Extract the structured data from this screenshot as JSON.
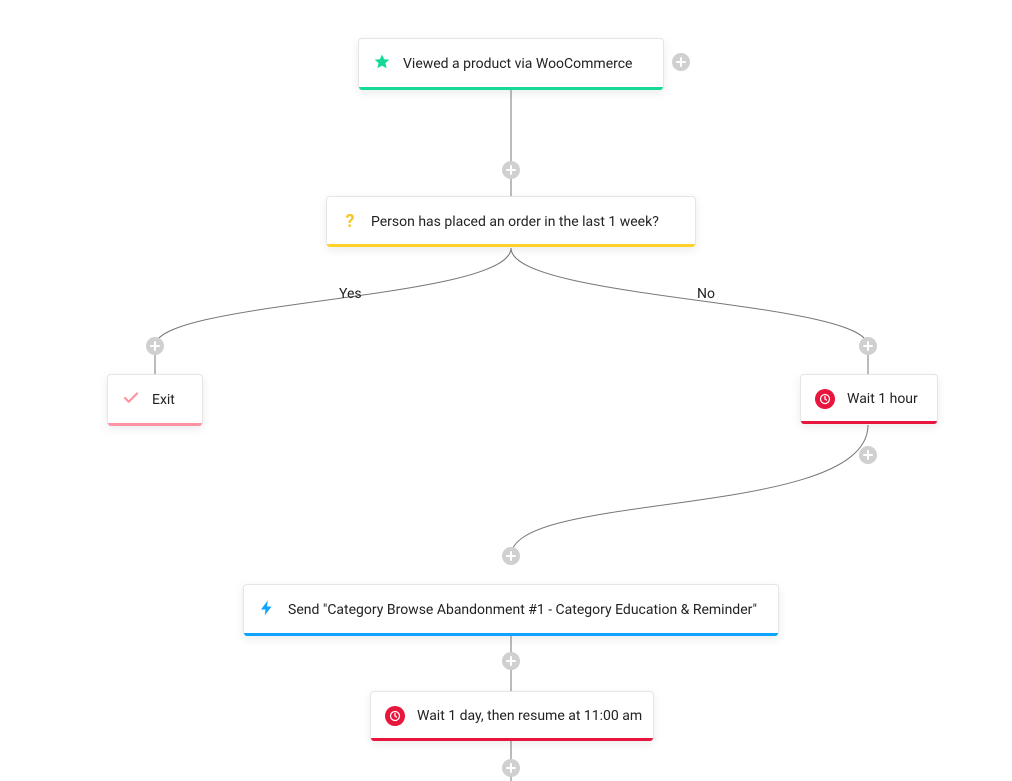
{
  "nodes": {
    "trigger": {
      "label": "Viewed a product via WooCommerce"
    },
    "condition": {
      "label": "Person has placed an order in the last 1 week?"
    },
    "exit": {
      "label": "Exit"
    },
    "wait1h": {
      "label": "Wait 1 hour"
    },
    "action": {
      "label": "Send \"Category Browse Abandonment #1 - Category Education & Reminder\""
    },
    "wait1d": {
      "label": "Wait 1 day, then resume at 11:00 am"
    }
  },
  "branches": {
    "yes": "Yes",
    "no": "No"
  },
  "colors": {
    "green": "#15d999",
    "yellow": "#ffd12b",
    "pink": "#fd94a3",
    "red": "#e8163c",
    "blue": "#0da3ff",
    "questionGlyph": "#f4c729",
    "boltGlyph": "#0da3ff",
    "checkGlyph": "#fd94a3",
    "plusBg": "#d0d0d0",
    "wire": "#777777"
  }
}
